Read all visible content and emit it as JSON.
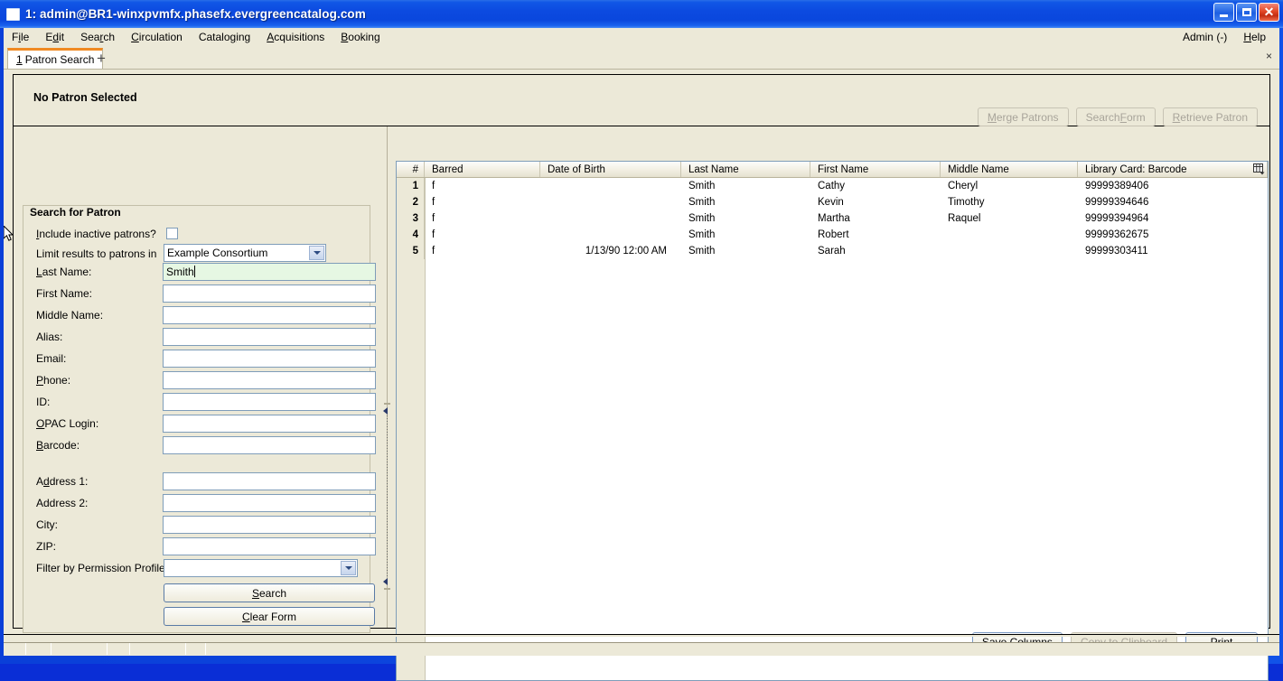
{
  "window": {
    "title": "1: admin@BR1-winxpvmfx.phasefx.evergreencatalog.com",
    "minimize_label": "Minimize",
    "maximize_label": "Maximize",
    "close_label": "Close"
  },
  "menubar": {
    "items": [
      {
        "label": "File",
        "mnemonic": "F"
      },
      {
        "label": "Edit",
        "mnemonic": "E"
      },
      {
        "label": "Search",
        "mnemonic": "r"
      },
      {
        "label": "Circulation",
        "mnemonic": "C"
      },
      {
        "label": "Cataloging",
        "mnemonic": "g"
      },
      {
        "label": "Acquisitions",
        "mnemonic": "A"
      },
      {
        "label": "Booking",
        "mnemonic": "B"
      }
    ],
    "admin_label": "Admin (-)",
    "help_label": "Help"
  },
  "tabs": {
    "active_tab_number": "1",
    "active_tab_label": "Patron Search",
    "new_tab_label": "+",
    "close_tab_label": "×"
  },
  "patron_header": {
    "title": "No Patron Selected",
    "buttons": [
      {
        "label": "Merge Patrons",
        "mnemonic": "M",
        "disabled": true
      },
      {
        "label": "Search Form",
        "mnemonic": "F",
        "disabled": true
      },
      {
        "label": "Retrieve Patron",
        "mnemonic": "R",
        "disabled": true
      }
    ]
  },
  "search_form": {
    "legend": "Search for Patron",
    "include_inactive_label": "Include inactive patrons?",
    "include_inactive_checked": false,
    "limit_results_label": "Limit results to patrons in",
    "limit_results_value": "Example Consortium",
    "fields": [
      {
        "label": "Last Name:",
        "value": "Smith",
        "focused": true
      },
      {
        "label": "First Name:",
        "value": "",
        "focused": false
      },
      {
        "label": "Middle Name:",
        "value": "",
        "focused": false
      },
      {
        "label": "Alias:",
        "value": "",
        "focused": false
      },
      {
        "label": "Email:",
        "value": "",
        "focused": false
      },
      {
        "label": "Phone:",
        "value": "",
        "focused": false
      },
      {
        "label": "ID:",
        "value": "",
        "focused": false
      },
      {
        "label": "OPAC Login:",
        "value": "",
        "focused": false
      },
      {
        "label": "Barcode:",
        "value": "",
        "focused": false
      },
      {
        "label": "Address 1:",
        "value": "",
        "focused": false
      },
      {
        "label": "Address 2:",
        "value": "",
        "focused": false
      },
      {
        "label": "City:",
        "value": "",
        "focused": false
      },
      {
        "label": "ZIP:",
        "value": "",
        "focused": false
      }
    ],
    "permission_profile_label": "Filter by Permission Profile:",
    "permission_profile_value": "",
    "search_button": "Search",
    "clear_button": "Clear Form"
  },
  "results": {
    "columns": [
      {
        "key": "num",
        "label": "#"
      },
      {
        "key": "barred",
        "label": "Barred"
      },
      {
        "key": "dob",
        "label": "Date of Birth"
      },
      {
        "key": "last",
        "label": "Last Name"
      },
      {
        "key": "first",
        "label": "First Name"
      },
      {
        "key": "middle",
        "label": "Middle Name"
      },
      {
        "key": "barcode",
        "label": "Library Card: Barcode"
      }
    ],
    "rows": [
      {
        "num": "1",
        "barred": "f",
        "dob": "",
        "last": "Smith",
        "first": "Cathy",
        "middle": "Cheryl",
        "barcode": "99999389406"
      },
      {
        "num": "2",
        "barred": "f",
        "dob": "",
        "last": "Smith",
        "first": "Kevin",
        "middle": "Timothy",
        "barcode": "99999394646"
      },
      {
        "num": "3",
        "barred": "f",
        "dob": "",
        "last": "Smith",
        "first": "Martha",
        "middle": "Raquel",
        "barcode": "99999394964"
      },
      {
        "num": "4",
        "barred": "f",
        "dob": "",
        "last": "Smith",
        "first": "Robert",
        "middle": "",
        "barcode": "99999362675"
      },
      {
        "num": "5",
        "barred": "f",
        "dob": "1/13/90 12:00 AM",
        "last": "Smith",
        "first": "Sarah",
        "middle": "",
        "barcode": "99999303411"
      }
    ],
    "column_picker_label": "Column picker",
    "footer_buttons": [
      {
        "label": "Save Columns",
        "disabled": false
      },
      {
        "label": "Copy to Clipboard",
        "disabled": true
      },
      {
        "label": "Print",
        "disabled": false
      }
    ]
  },
  "statusbar": {
    "segments": [
      "",
      "",
      "",
      "",
      "",
      "",
      ""
    ]
  },
  "colors": {
    "titlebar_blue": "#0a47dd",
    "window_face": "#ece9d8",
    "active_field_green": "#e6f7e3",
    "tab_accent_orange": "#f08a23",
    "field_border": "#7f9db9"
  }
}
